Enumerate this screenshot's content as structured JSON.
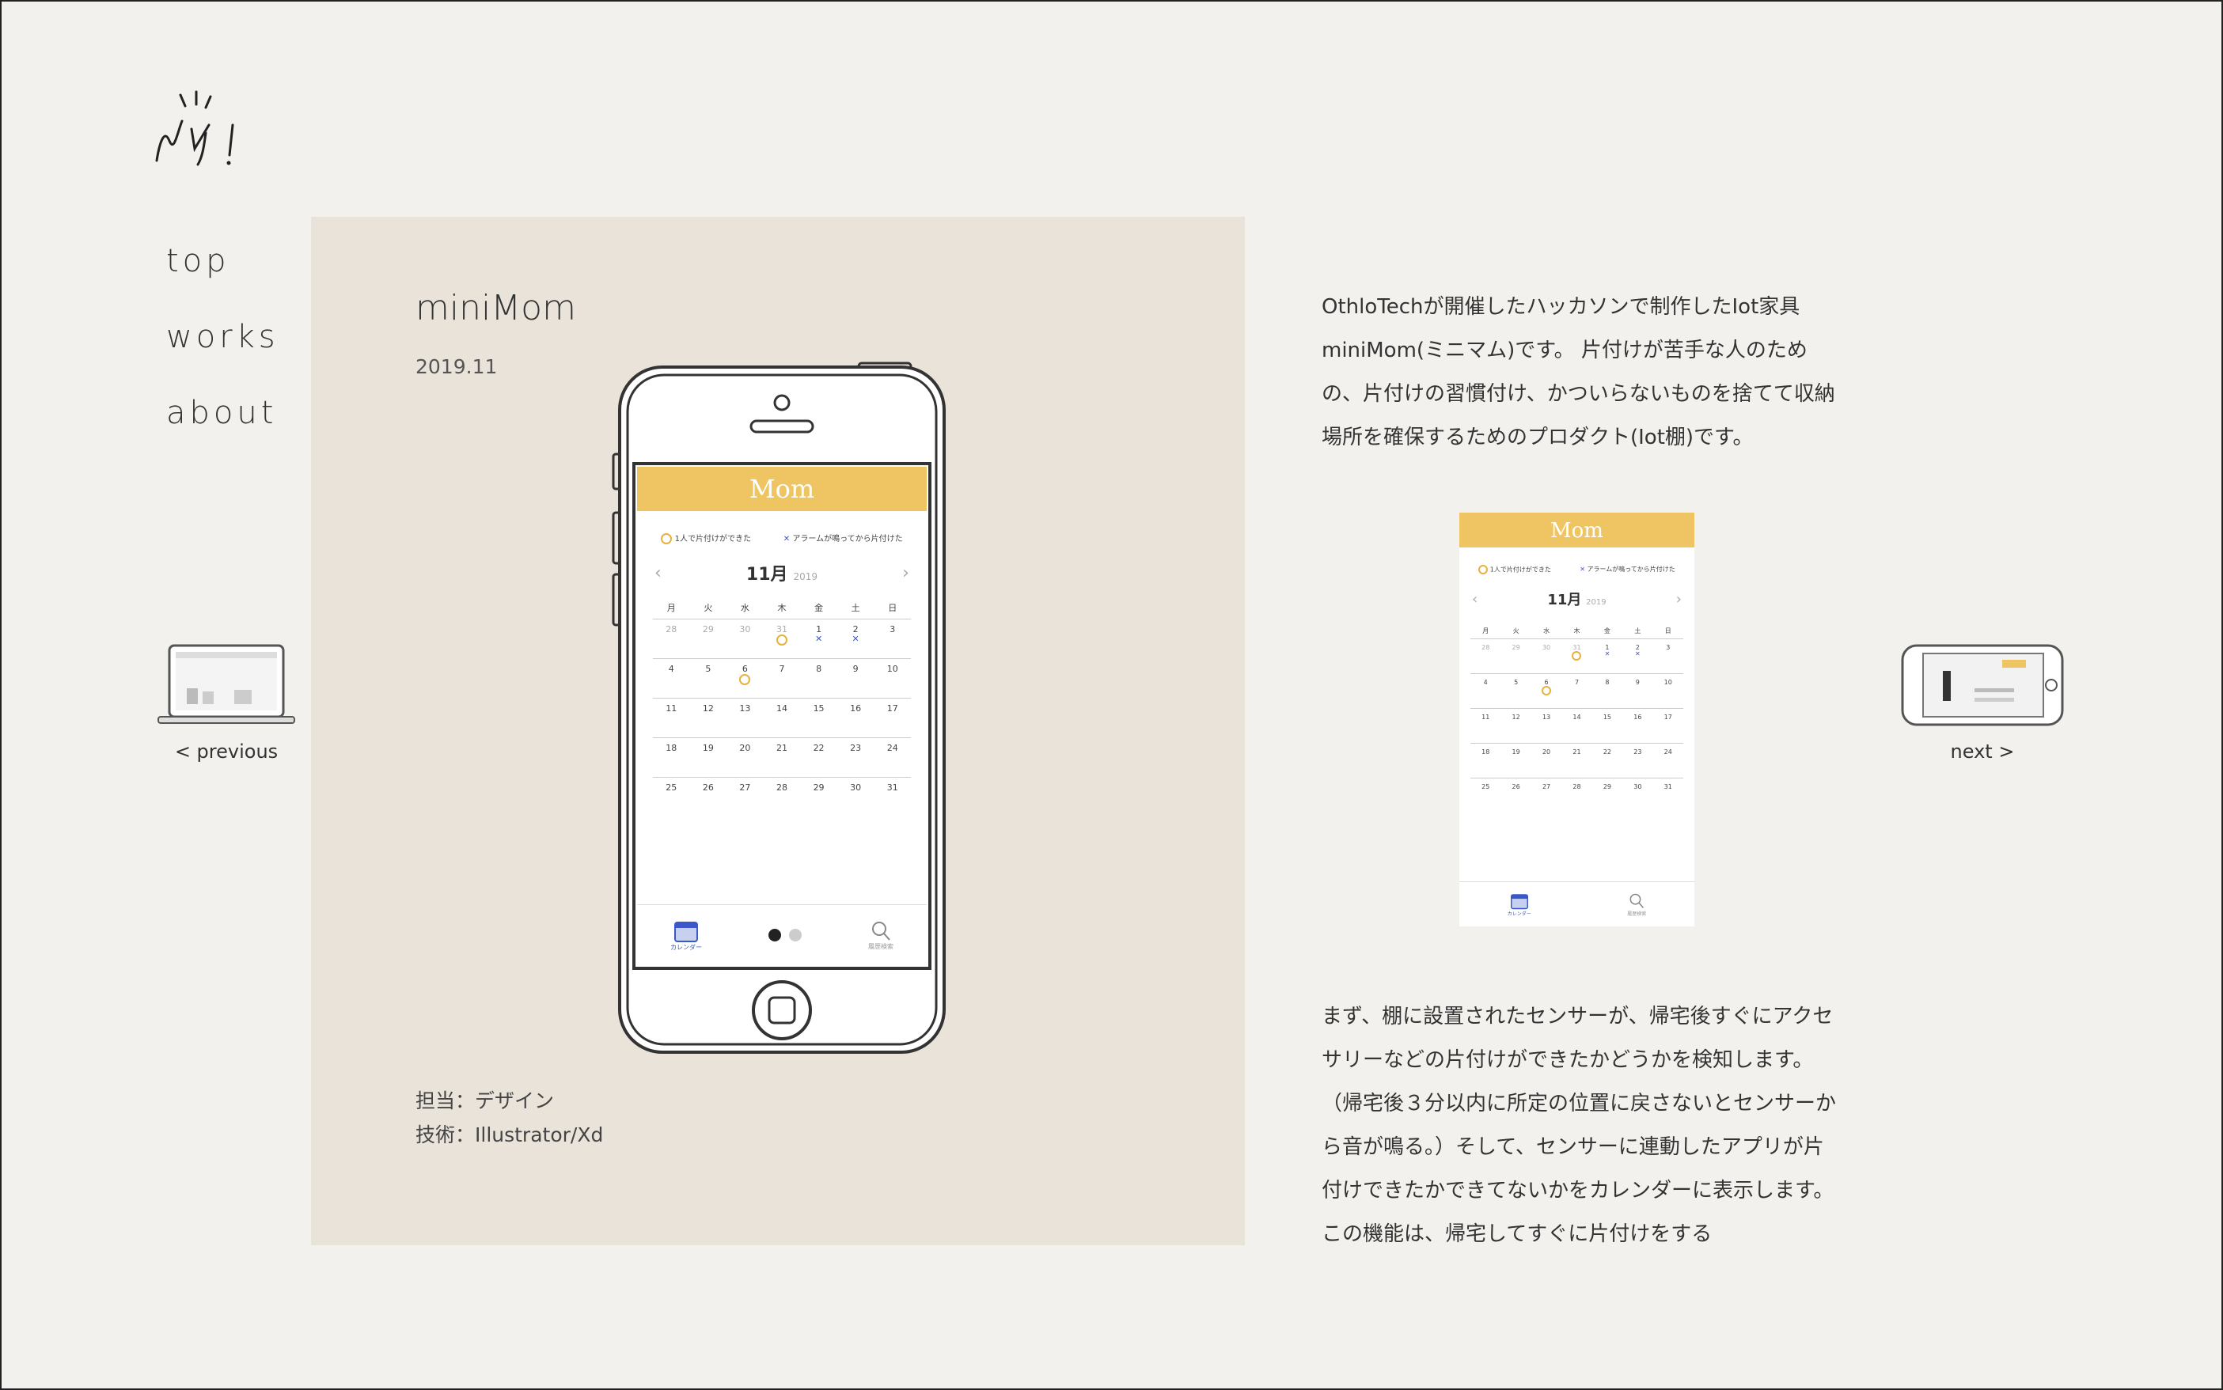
{
  "nav": {
    "items": [
      "top",
      "works",
      "about"
    ]
  },
  "previous": {
    "label": "< previous"
  },
  "next": {
    "label": "next >"
  },
  "work": {
    "title": "miniMom",
    "date": "2019.11",
    "role": "担当：デザイン",
    "tech": "技術：Illustrator/Xd"
  },
  "app": {
    "logo": "Mom",
    "legend_done": "1人で片付けができた",
    "legend_alarm": "アラームが鳴ってから片付けた",
    "month": "11月",
    "year": "2019",
    "weekdays": [
      "月",
      "火",
      "水",
      "木",
      "金",
      "土",
      "日"
    ],
    "days": [
      {
        "d": "28",
        "m": true
      },
      {
        "d": "29",
        "m": true
      },
      {
        "d": "30",
        "m": true
      },
      {
        "d": "31",
        "m": true,
        "mark": "o"
      },
      {
        "d": "1",
        "mark": "x"
      },
      {
        "d": "2",
        "mark": "x"
      },
      {
        "d": "3"
      },
      {
        "d": "4"
      },
      {
        "d": "5"
      },
      {
        "d": "6",
        "mark": "o"
      },
      {
        "d": "7"
      },
      {
        "d": "8"
      },
      {
        "d": "9"
      },
      {
        "d": "10"
      },
      {
        "d": "11"
      },
      {
        "d": "12"
      },
      {
        "d": "13"
      },
      {
        "d": "14"
      },
      {
        "d": "15"
      },
      {
        "d": "16"
      },
      {
        "d": "17"
      },
      {
        "d": "18"
      },
      {
        "d": "19"
      },
      {
        "d": "20"
      },
      {
        "d": "21"
      },
      {
        "d": "22"
      },
      {
        "d": "23"
      },
      {
        "d": "24"
      },
      {
        "d": "25"
      },
      {
        "d": "26"
      },
      {
        "d": "27"
      },
      {
        "d": "28"
      },
      {
        "d": "29"
      },
      {
        "d": "30"
      },
      {
        "d": "31"
      }
    ],
    "tab_calendar": "カレンダー",
    "tab_search": "履歴検索"
  },
  "description": {
    "intro": "OthloTechが開催したハッカソンで制作したIot家具miniMom(ミニマム)です。 片付けが苦手な人のための、片付けの習慣付け、かついらないものを捨てて収納場所を確保するためのプロダクト(Iot棚)です。",
    "body": "まず、棚に設置されたセンサーが、帰宅後すぐにアクセサリーなどの片付けができたかどうかを検知します。（帰宅後３分以内に所定の位置に戻さないとセンサーから音が鳴る。）そして、センサーに連動したアプリが片付けできたかできてないかをカレンダーに表示します。 この機能は、帰宅してすぐに片付けをする"
  }
}
